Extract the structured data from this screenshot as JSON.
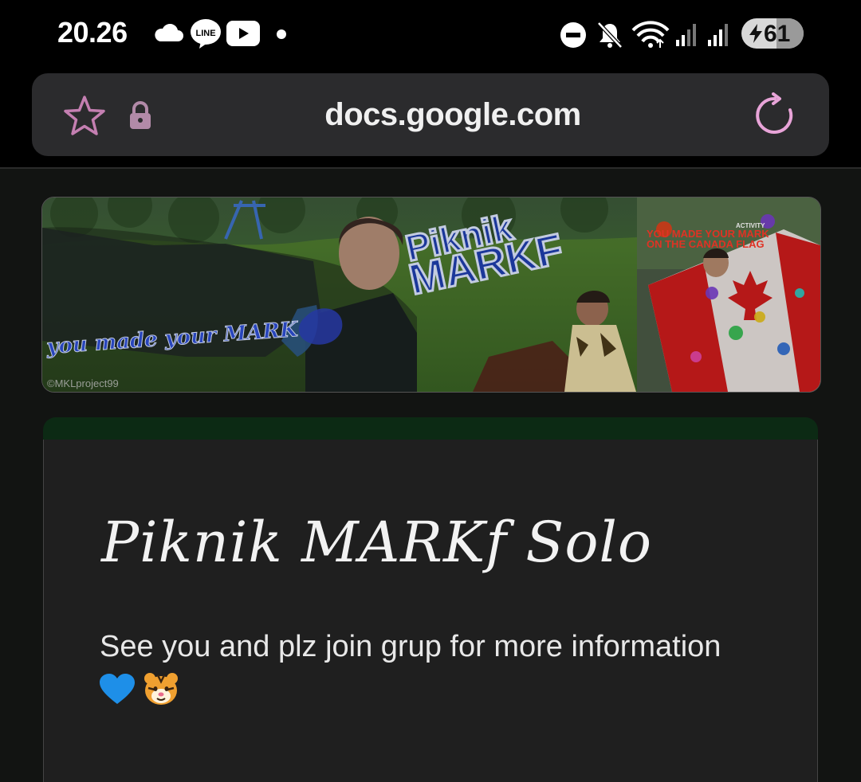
{
  "status_bar": {
    "time": "20.26",
    "icons": [
      "cloud-icon",
      "line-app-icon",
      "youtube-icon",
      "dot-icon",
      "dnd-icon",
      "mute-icon",
      "wifi-icon",
      "signal-icon-1",
      "signal-icon-2"
    ],
    "battery_level": "61"
  },
  "browser": {
    "url": "docs.google.com",
    "icons": [
      "star-icon",
      "lock-icon",
      "reload-icon"
    ],
    "accent_color": "#e8a4d8"
  },
  "banner": {
    "left_text": "you made your MARK",
    "title_line1": "Piknik",
    "title_line2": "MARKF",
    "activity_label": "ACTIVITY",
    "activity_line1": "YOU MADE YOUR MARK",
    "activity_line2": "ON THE CANADA FLAG",
    "watermark": "©MKLproject99"
  },
  "form": {
    "title": "Piknik MARKf Solo",
    "description": "See you and plz join grup for more information",
    "description_emojis": [
      "blue-heart",
      "tiger-face"
    ],
    "header_color": "#0c2a14"
  }
}
